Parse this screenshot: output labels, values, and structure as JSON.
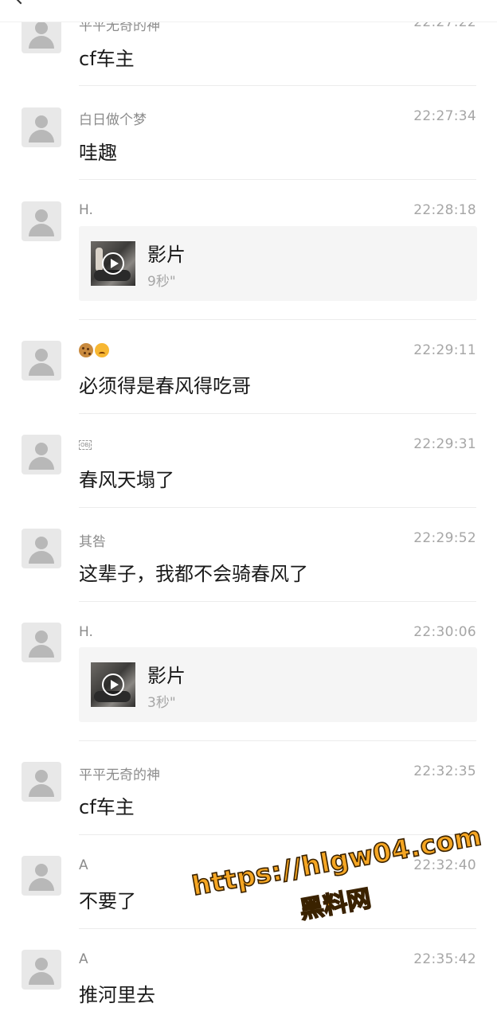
{
  "messages": [
    {
      "sender": "平平无奇的神",
      "time": "22:27:22",
      "text": "cf车主"
    },
    {
      "sender": "白日做个梦",
      "time": "22:27:34",
      "text": "哇趣"
    },
    {
      "sender": "H.",
      "time": "22:28:18",
      "video": {
        "title": "影片",
        "duration": "9秒\""
      }
    },
    {
      "sender_emoji": [
        "cookie-emoji",
        "angry-face-emoji"
      ],
      "time": "22:29:11",
      "text": "必须得是春风得吃哥"
    },
    {
      "sender_obj": "OBJ",
      "time": "22:29:31",
      "text": "春风天塌了"
    },
    {
      "sender": "其咎",
      "time": "22:29:52",
      "text": "这辈子，我都不会骑春风了"
    },
    {
      "sender": "H.",
      "time": "22:30:06",
      "video": {
        "title": "影片",
        "duration": "3秒\""
      }
    },
    {
      "sender": "平平无奇的神",
      "time": "22:32:35",
      "text": "cf车主"
    },
    {
      "sender": "A",
      "time": "22:32:40",
      "text": "不要了"
    },
    {
      "sender": "A",
      "time": "22:35:42",
      "text": "推河里去"
    }
  ],
  "watermark": {
    "url": "https://hlgw04.com",
    "label": "黑料网"
  }
}
